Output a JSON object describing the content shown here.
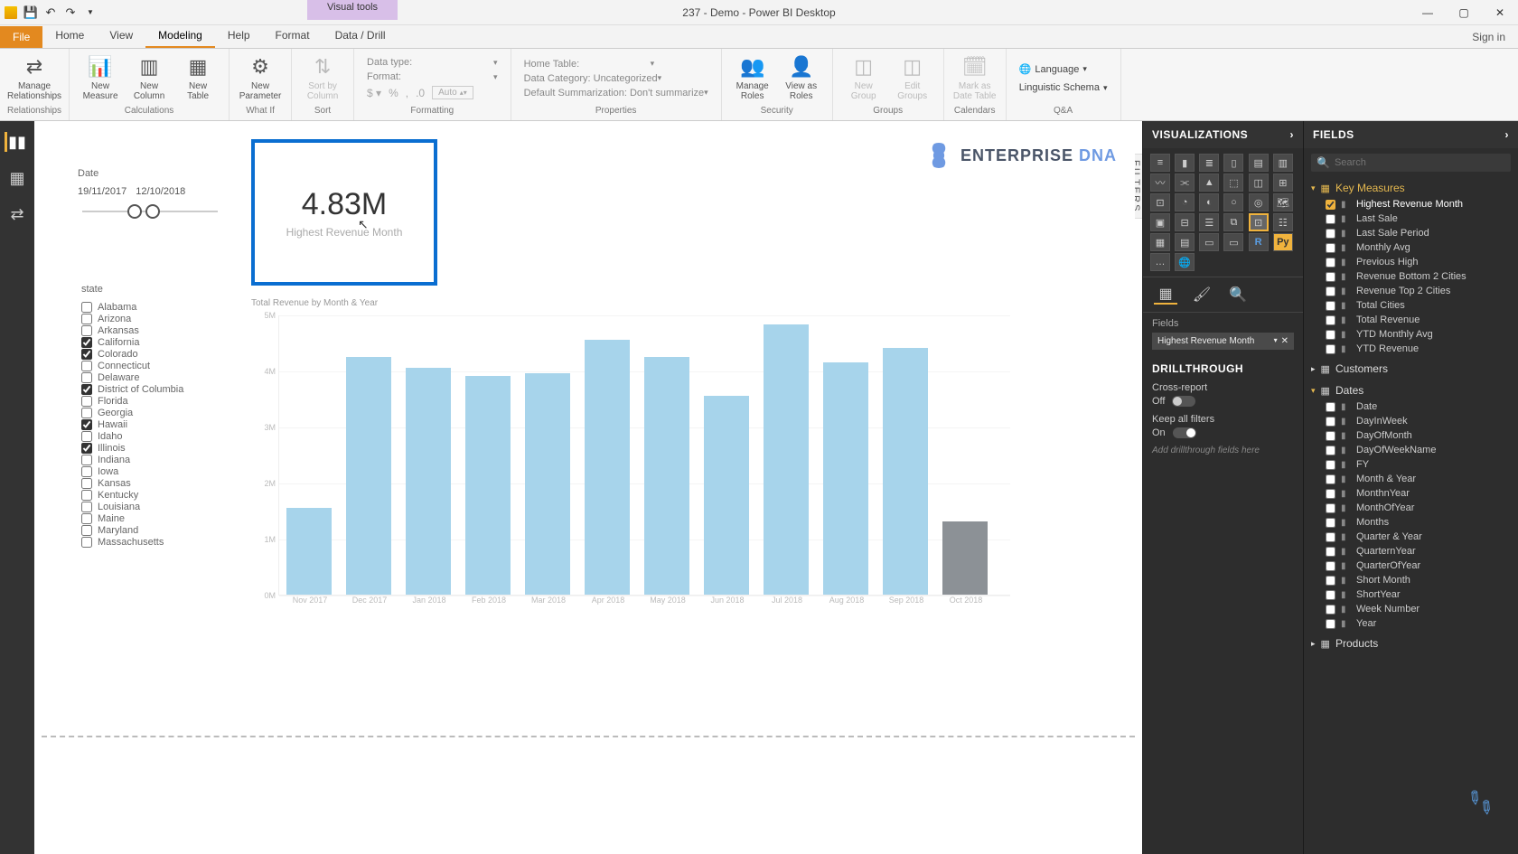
{
  "titlebar": {
    "contextual_tab": "Visual tools",
    "title": "237 - Demo - Power BI Desktop",
    "signin": "Sign in"
  },
  "menu": {
    "file": "File",
    "tabs": [
      "Home",
      "View",
      "Modeling",
      "Help",
      "Format",
      "Data / Drill"
    ],
    "active": 2
  },
  "ribbon": {
    "relationships": {
      "manage": "Manage\nRelationships",
      "group": "Relationships"
    },
    "calculations": {
      "measure": "New\nMeasure",
      "column": "New\nColumn",
      "table": "New\nTable",
      "group": "Calculations"
    },
    "whatif": {
      "param": "New\nParameter",
      "group": "What If"
    },
    "sort": {
      "sortby": "Sort by\nColumn",
      "group": "Sort"
    },
    "formatting": {
      "datatype_label": "Data type:",
      "format_label": "Format:",
      "auto": "Auto",
      "group": "Formatting"
    },
    "properties": {
      "hometable_label": "Home Table:",
      "datacat_label": "Data Category:",
      "datacat_val": "Uncategorized",
      "defsum_label": "Default Summarization:",
      "defsum_val": "Don't summarize",
      "group": "Properties"
    },
    "security": {
      "roles": "Manage\nRoles",
      "viewas": "View as\nRoles",
      "group": "Security"
    },
    "groups": {
      "newg": "New\nGroup",
      "editg": "Edit\nGroups",
      "group": "Groups"
    },
    "calendars": {
      "mark": "Mark as\nDate Table",
      "group": "Calendars"
    },
    "qa": {
      "lang": "Language",
      "schema": "Linguistic Schema",
      "group": "Q&A"
    }
  },
  "canvas": {
    "filters_label": "FILTERS",
    "brand": {
      "t1": "ENTERPRISE ",
      "t2": "DNA"
    },
    "date_slicer": {
      "label": "Date",
      "from": "19/11/2017",
      "to": "12/10/2018"
    },
    "card": {
      "value": "4.83M",
      "label": "Highest Revenue Month"
    },
    "state_slicer": {
      "label": "state",
      "items": [
        {
          "name": "Alabama",
          "c": false
        },
        {
          "name": "Arizona",
          "c": false
        },
        {
          "name": "Arkansas",
          "c": false
        },
        {
          "name": "California",
          "c": true
        },
        {
          "name": "Colorado",
          "c": true
        },
        {
          "name": "Connecticut",
          "c": false
        },
        {
          "name": "Delaware",
          "c": false
        },
        {
          "name": "District of Columbia",
          "c": true
        },
        {
          "name": "Florida",
          "c": false
        },
        {
          "name": "Georgia",
          "c": false
        },
        {
          "name": "Hawaii",
          "c": true
        },
        {
          "name": "Idaho",
          "c": false
        },
        {
          "name": "Illinois",
          "c": true
        },
        {
          "name": "Indiana",
          "c": false
        },
        {
          "name": "Iowa",
          "c": false
        },
        {
          "name": "Kansas",
          "c": false
        },
        {
          "name": "Kentucky",
          "c": false
        },
        {
          "name": "Louisiana",
          "c": false
        },
        {
          "name": "Maine",
          "c": false
        },
        {
          "name": "Maryland",
          "c": false
        },
        {
          "name": "Massachusetts",
          "c": false
        }
      ]
    }
  },
  "chart_data": {
    "type": "bar",
    "title": "Total Revenue by Month & Year",
    "xlabel": "",
    "ylabel": "",
    "ylim": [
      0,
      5
    ],
    "y_unit": "M",
    "categories": [
      "Nov 2017",
      "Dec 2017",
      "Jan 2018",
      "Feb 2018",
      "Mar 2018",
      "Apr 2018",
      "May 2018",
      "Jun 2018",
      "Jul 2018",
      "Aug 2018",
      "Sep 2018",
      "Oct 2018"
    ],
    "values": [
      1.55,
      4.25,
      4.05,
      3.9,
      3.95,
      4.55,
      4.25,
      3.55,
      4.83,
      4.15,
      4.4,
      1.3
    ],
    "muted_index": 11,
    "y_ticks": [
      0,
      1,
      2,
      3,
      4,
      5
    ]
  },
  "viz_pane": {
    "title": "VISUALIZATIONS",
    "fields_label": "Fields",
    "well_value": "Highest Revenue Month",
    "drill_title": "DRILLTHROUGH",
    "cross_label": "Cross-report",
    "cross_val": "Off",
    "keep_label": "Keep all filters",
    "keep_val": "On",
    "placeholder": "Add drillthrough fields here"
  },
  "fields_pane": {
    "title": "FIELDS",
    "search_placeholder": "Search",
    "tables": [
      {
        "name": "Key Measures",
        "expanded": true,
        "accent": true,
        "fields": [
          {
            "name": "Highest Revenue Month",
            "c": true
          },
          {
            "name": "Last Sale",
            "c": false
          },
          {
            "name": "Last Sale Period",
            "c": false
          },
          {
            "name": "Monthly Avg",
            "c": false
          },
          {
            "name": "Previous High",
            "c": false
          },
          {
            "name": "Revenue Bottom 2 Cities",
            "c": false
          },
          {
            "name": "Revenue Top 2 Cities",
            "c": false
          },
          {
            "name": "Total Cities",
            "c": false
          },
          {
            "name": "Total Revenue",
            "c": false
          },
          {
            "name": "YTD Monthly Avg",
            "c": false
          },
          {
            "name": "YTD Revenue",
            "c": false
          }
        ]
      },
      {
        "name": "Customers",
        "expanded": false
      },
      {
        "name": "Dates",
        "expanded": true,
        "fields": [
          {
            "name": "Date",
            "c": false
          },
          {
            "name": "DayInWeek",
            "c": false
          },
          {
            "name": "DayOfMonth",
            "c": false
          },
          {
            "name": "DayOfWeekName",
            "c": false
          },
          {
            "name": "FY",
            "c": false
          },
          {
            "name": "Month & Year",
            "c": false
          },
          {
            "name": "MonthnYear",
            "c": false
          },
          {
            "name": "MonthOfYear",
            "c": false
          },
          {
            "name": "Months",
            "c": false
          },
          {
            "name": "Quarter & Year",
            "c": false
          },
          {
            "name": "QuarternYear",
            "c": false
          },
          {
            "name": "QuarterOfYear",
            "c": false
          },
          {
            "name": "Short Month",
            "c": false
          },
          {
            "name": "ShortYear",
            "c": false
          },
          {
            "name": "Week Number",
            "c": false
          },
          {
            "name": "Year",
            "c": false
          }
        ]
      },
      {
        "name": "Products",
        "expanded": false
      }
    ]
  }
}
